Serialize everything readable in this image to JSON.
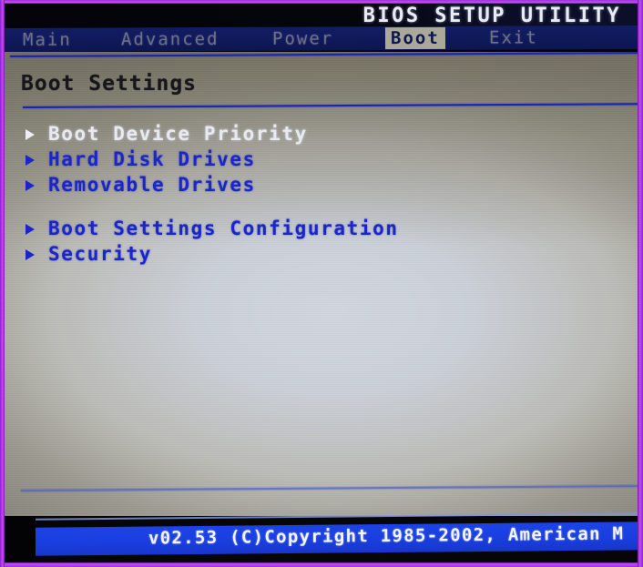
{
  "window": {
    "title": "BIOS SETUP UTILITY"
  },
  "menu_bar": {
    "tabs": [
      {
        "label": "Main",
        "selected": false
      },
      {
        "label": "Advanced",
        "selected": false
      },
      {
        "label": "Power",
        "selected": false
      },
      {
        "label": "Boot",
        "selected": true
      },
      {
        "label": "Exit",
        "selected": false
      }
    ]
  },
  "content": {
    "section_title": "Boot Settings",
    "items": [
      {
        "label": "Boot Device Priority",
        "bullet": "right-triangle-icon",
        "highlighted": true
      },
      {
        "label": "Hard Disk Drives",
        "bullet": "right-triangle-icon",
        "highlighted": false
      },
      {
        "label": "Removable Drives",
        "bullet": "right-triangle-icon",
        "highlighted": false
      },
      {
        "label": "Boot Settings Configuration",
        "bullet": "right-triangle-icon",
        "highlighted": false
      },
      {
        "label": "Security",
        "bullet": "right-triangle-icon",
        "highlighted": false
      }
    ]
  },
  "footer": {
    "text": "v02.53 (C)Copyright 1985-2002, American M"
  },
  "colors": {
    "menu_bar_blue": "#101a5c",
    "selected_tab_bg": "#aaa79b",
    "item_blue": "#1b26c8",
    "highlight_white": "#e7eaf0",
    "footer_blue": "#1a3fe0",
    "rule_blue": "#1a23b4",
    "bezel_magenta": "#c54ff5"
  }
}
